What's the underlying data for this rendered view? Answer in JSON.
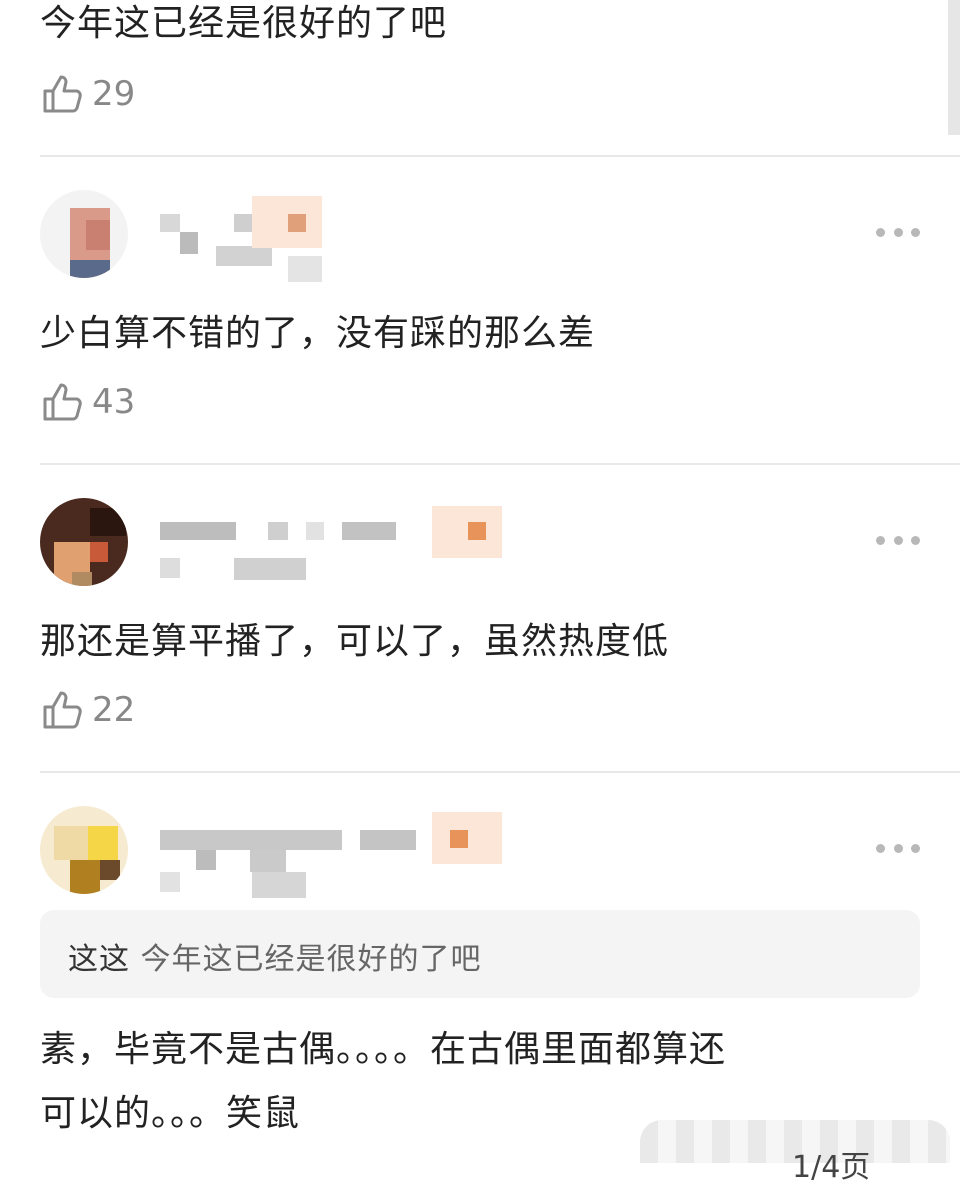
{
  "comments": [
    {
      "text": "今年这已经是很好的了吧",
      "likes": "29"
    },
    {
      "text": "少白算不错的了，没有踩的那么差",
      "likes": "43"
    },
    {
      "text": "那还是算平播了，可以了，虽然热度低",
      "likes": "22"
    },
    {
      "quote_author": "这这",
      "quote_text": "今年这已经是很好的了吧",
      "text_line1": "素，毕竟不是古偶。。。。在古偶里面都算还",
      "text_line2": "可以的。。。笑鼠"
    }
  ],
  "icons": {
    "like": "thumbs-up-icon",
    "more": "more-dots-icon"
  },
  "page_indicator": "1/4页",
  "colors": {
    "text": "#222222",
    "secondary": "#888888",
    "divider": "#e8e8e8",
    "quote_bg": "#f4f4f4"
  }
}
